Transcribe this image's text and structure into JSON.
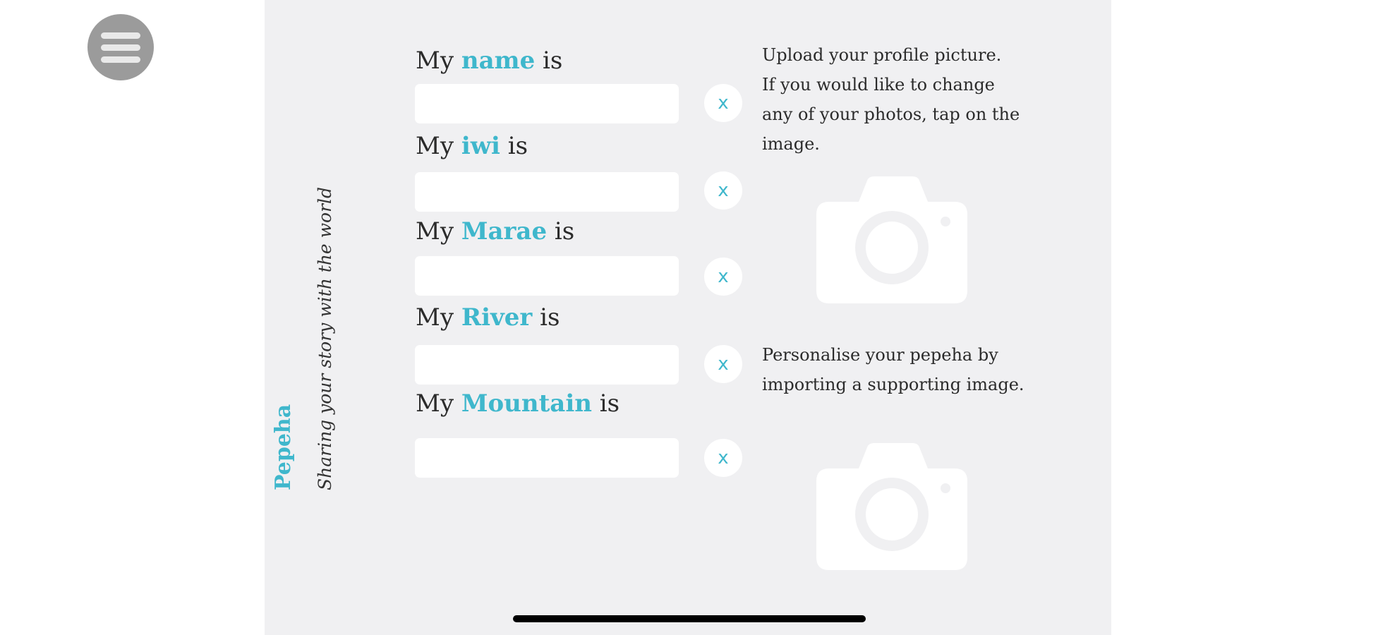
{
  "app": {
    "title": "Pepeha",
    "subtitle": "Sharing your story with the world"
  },
  "fields": [
    {
      "prefix": "My",
      "keyword": "name",
      "suffix": "is",
      "value": "",
      "clear_label": "x"
    },
    {
      "prefix": "My",
      "keyword": "iwi",
      "suffix": "is",
      "value": "",
      "clear_label": "x"
    },
    {
      "prefix": "My",
      "keyword": "Marae",
      "suffix": "is",
      "value": "",
      "clear_label": "x"
    },
    {
      "prefix": "My",
      "keyword": "River",
      "suffix": "is",
      "value": "",
      "clear_label": "x"
    },
    {
      "prefix": "My",
      "keyword": "Mountain",
      "suffix": "is",
      "value": "",
      "clear_label": "x"
    }
  ],
  "profile_upload": {
    "text": "Upload your profile picture.\nIf you would like to change\nany of your photos, tap on the\nimage.",
    "icon": "camera-icon"
  },
  "supporting_upload": {
    "text": "Personalise your pepeha by\nimporting a supporting image.",
    "icon": "camera-icon"
  },
  "colors": {
    "accent": "#3fb7cc",
    "panel_bg": "#f0f0f2",
    "menu_bg": "#9b9b9b"
  }
}
